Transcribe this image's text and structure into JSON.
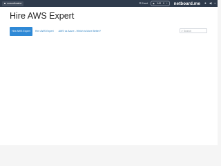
{
  "topbar": {
    "user_label": "cursorlimaine",
    "events_label": "Event",
    "counter_left": "0.00",
    "counter_right": "0",
    "brand": "netboard.me",
    "icons": [
      "menu-icon",
      "eye-icon",
      "plus-icon",
      "user-icon",
      "chat-icon"
    ]
  },
  "main": {
    "title": "Hire AWS Expert",
    "tabs": [
      {
        "label": "Hire AWS Expert",
        "active": true
      },
      {
        "label": "Hire AWS Expert",
        "active": false
      },
      {
        "label": "AWS vs Azure - Which is More Better?",
        "active": false
      }
    ],
    "search": {
      "placeholder": "Search",
      "value": ""
    }
  },
  "colors": {
    "topbar": "#2f3b4c",
    "accent": "#2f89d6",
    "link": "#2a7fc0",
    "background": "#f5f5f5"
  }
}
